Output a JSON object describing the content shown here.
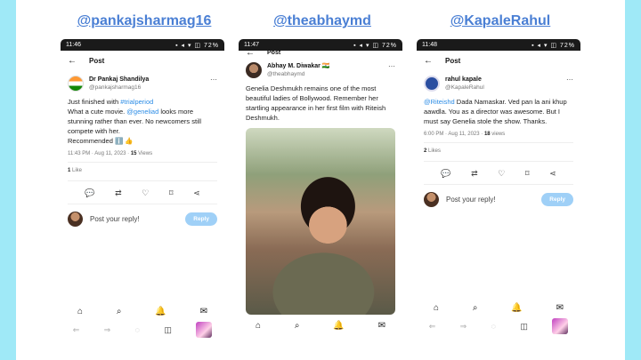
{
  "columns": [
    {
      "handle": "@pankajsharmag16",
      "status": {
        "time": "11:46",
        "icons": "▪ ◂ ▾ ◫ 72%"
      },
      "topbar": {
        "back": "←",
        "title": "Post"
      },
      "author": {
        "name": "Dr Pankaj Shandilya",
        "user": "@pankajsharmag16"
      },
      "body": {
        "pre": "Just finished with ",
        "hashtag": "#trialperiod",
        "line2_pre": "What a cute movie. ",
        "mention": "@geneliad",
        "line2_post": " looks more stunning rather than ever. No newcomers still compete with her.",
        "line3": "Recommended ℹ️ 👍"
      },
      "meta": {
        "time": "11:43 PM · Aug 11, 2023 · ",
        "views": "15",
        "views_label": " Views"
      },
      "likes": {
        "count": "1",
        "label": " Like"
      },
      "reply": {
        "placeholder": "Post your reply!",
        "button": "Reply"
      }
    },
    {
      "handle": "@theabhaymd",
      "status": {
        "time": "11:47",
        "icons": "▪ ◂ ▾ ◫ 72%"
      },
      "topbar": {
        "back": "←",
        "title": "Post"
      },
      "author": {
        "name": "Abhay M. Diwakar 🇮🇳",
        "user": "@theabhaymd"
      },
      "body": {
        "text": "Genelia Deshmukh remains one of the most beautiful ladies of Bollywood. Remember her startling appearance in her first film with Riteish Deshmukh."
      }
    },
    {
      "handle": "@KapaleRahul",
      "status": {
        "time": "11:48",
        "icons": "▪ ◂ ▾ ◫ 72%"
      },
      "topbar": {
        "back": "←",
        "title": "Post"
      },
      "author": {
        "name": "rahul kapale",
        "user": "@KapaleRahul"
      },
      "body": {
        "mention": "@Riteishd",
        "text": " Dada Namaskar. Ved pan la ani khup aawdla. You as a director was awesome. But I must say Genelia stole the show. Thanks."
      },
      "meta": {
        "time": "6:00 PM · Aug 11, 2023 · ",
        "views": "18",
        "views_label": " views"
      },
      "likes": {
        "count": "2",
        "label": " Likes"
      },
      "reply": {
        "placeholder": "Post your reply!",
        "button": "Reply"
      }
    }
  ],
  "nav_icons": [
    "home-icon",
    "search-icon",
    "bell-icon",
    "mail-icon"
  ],
  "browser_icons": [
    "back-icon",
    "forward-icon",
    "reload-icon",
    "tabs-icon"
  ],
  "colors": {
    "edge": "#9fe9f7",
    "handle": "#4a7fd4",
    "link": "#2b8ce6",
    "reply_button": "#9fd0f7"
  }
}
